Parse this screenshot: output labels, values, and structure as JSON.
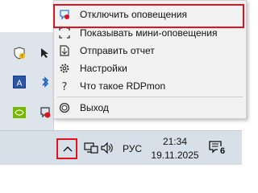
{
  "menu": {
    "items": [
      {
        "label": "Отключить оповещения",
        "icon": "notification-off-icon"
      },
      {
        "label": "Показывать мини-оповещения",
        "icon": "mini-notify-icon"
      },
      {
        "label": "Отправить отчет",
        "icon": "send-report-icon"
      },
      {
        "label": "Настройки",
        "icon": "gear-icon"
      },
      {
        "label": "Что такое RDPmon",
        "icon": "question-icon"
      },
      {
        "label": "Выход",
        "icon": "exit-icon"
      }
    ]
  },
  "taskbar": {
    "language": "РУС",
    "time": "21:34",
    "date": "19.11.2025",
    "notification_count": "6"
  },
  "colors": {
    "highlight": "#e0141e",
    "accent": "#2c7be5"
  }
}
